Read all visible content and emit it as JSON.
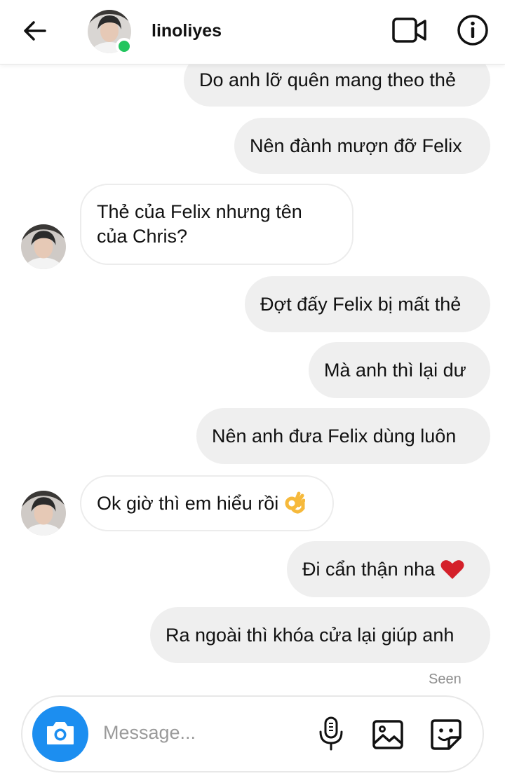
{
  "header": {
    "username": "linoliyes",
    "status_color": "#22c55e",
    "icons": [
      "back-arrow-icon",
      "video-call-icon",
      "info-icon"
    ]
  },
  "messages": [
    {
      "from": "me",
      "text": "Do anh lỡ quên mang theo thẻ"
    },
    {
      "from": "me",
      "text": "Nên đành mượn đỡ Felix"
    },
    {
      "from": "them",
      "text": "Thẻ của Felix nhưng tên của Chris?"
    },
    {
      "from": "me",
      "text": "Đợt đấy Felix bị mất thẻ"
    },
    {
      "from": "me",
      "text": "Mà anh thì lại dư"
    },
    {
      "from": "me",
      "text": "Nên anh đưa Felix dùng luôn"
    },
    {
      "from": "them",
      "text": "Ok giờ thì em hiểu rồi",
      "emoji": "ok-hand-emoji"
    },
    {
      "from": "me",
      "text": "Đi cẩn thận nha",
      "emoji": "red-heart-emoji"
    },
    {
      "from": "me",
      "text": "Ra ngoài thì khóa cửa lại giúp anh"
    }
  ],
  "seen_label": "Seen",
  "composer": {
    "placeholder": "Message...",
    "camera_color": "#1c8ef0",
    "icons": [
      "camera-icon",
      "microphone-icon",
      "gallery-icon",
      "sticker-icon"
    ]
  }
}
